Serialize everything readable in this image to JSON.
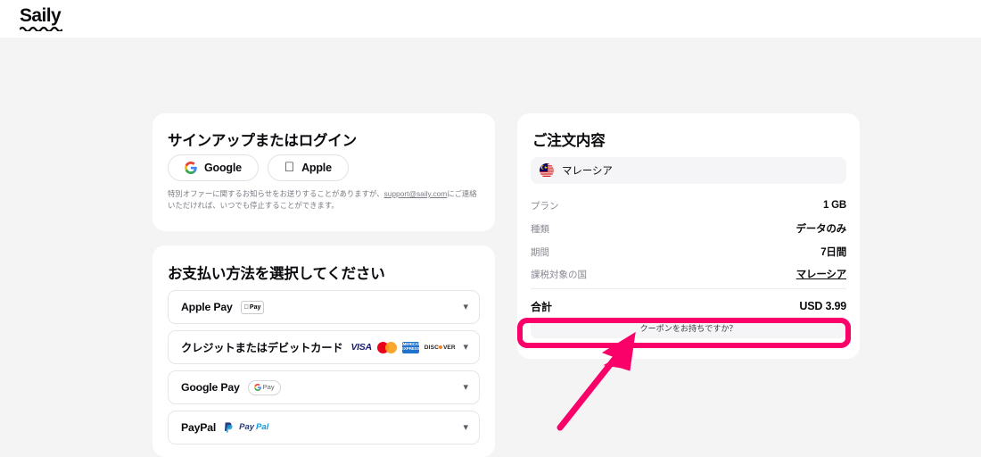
{
  "header": {
    "logo_text": "Saily"
  },
  "signup_card": {
    "title": "サインアップまたはログイン",
    "google_button": "Google",
    "apple_button": "Apple",
    "disclaimer_before": "特別オファーに関するお知らせをお送りすることがありますが、",
    "disclaimer_link": "support@saily.com",
    "disclaimer_after": "にご連絡いただければ、いつでも停止することができます。"
  },
  "payment_card": {
    "title": "お支払い方法を選択してください",
    "methods": [
      {
        "name": "Apple Pay",
        "badge": "apple-pay-badge",
        "chevron": "chevron-down-icon"
      },
      {
        "name": "クレジットまたはデビットカード",
        "badge": "card-network-logos",
        "chevron": "chevron-down-icon"
      },
      {
        "name": "Google Pay",
        "badge": "google-pay-badge",
        "chevron": "chevron-down-icon"
      },
      {
        "name": "PayPal",
        "badge": "paypal-badge",
        "chevron": "chevron-down-icon"
      }
    ],
    "card_networks": [
      "VISA",
      "Mastercard",
      "AMEX",
      "DISCOVER"
    ],
    "apple_pay_badge": {
      "mark": "",
      "word": "Pay"
    },
    "google_pay_badge": {
      "word": "Pay"
    },
    "paypal_badge": {
      "first": "Pay",
      "second": "Pal"
    },
    "amex_badge": {
      "line1": "AMERICAN",
      "line2": "EXPRESS"
    },
    "discover_badge": {
      "before": "DISC",
      "after": "VER"
    },
    "visa_badge": "VISA"
  },
  "summary_card": {
    "title": "ご注文内容",
    "country": {
      "name": "マレーシア",
      "flag": "malaysia-flag-icon"
    },
    "rows": [
      {
        "label": "プラン",
        "value": "1 GB",
        "link": false
      },
      {
        "label": "種類",
        "value": "データのみ",
        "link": false
      },
      {
        "label": "期間",
        "value": "7日間",
        "link": false
      },
      {
        "label": "課税対象の国",
        "value": "マレーシア",
        "link": true
      }
    ],
    "total": {
      "label": "合計",
      "value": "USD 3.99"
    },
    "coupon_button": "クーポンをお持ちですか？"
  },
  "annotation": {
    "highlight_color": "#fa0069",
    "arrow_color": "#fa0069",
    "target": "coupon-button"
  },
  "colors": {
    "page_background": "#f4f4f5",
    "card_background": "#ffffff",
    "text_primary": "#0b0b0f",
    "text_muted": "#8a8a93",
    "accent_pink": "#fa0069"
  }
}
